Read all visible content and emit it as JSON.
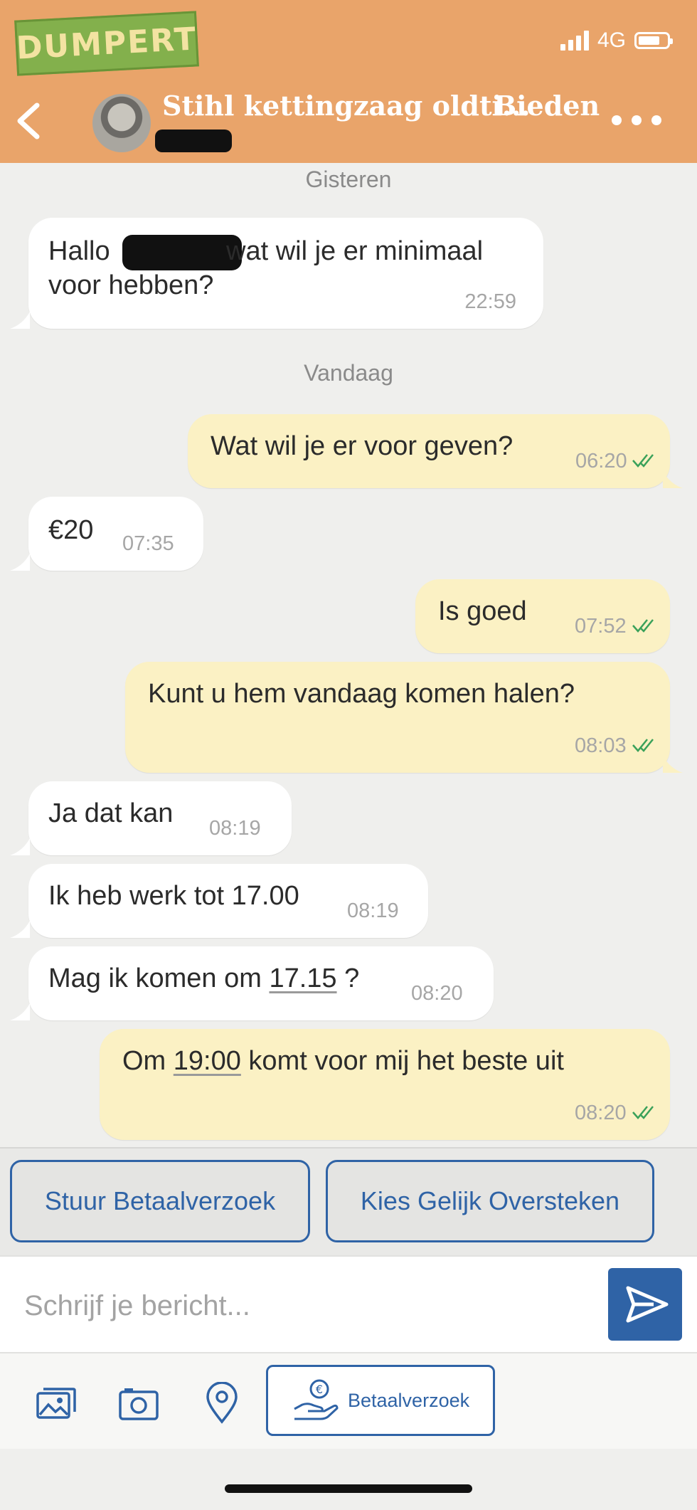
{
  "status_bar": {
    "network": "4G",
    "battery_level": 0.75,
    "watermark": "DUMPERT"
  },
  "header": {
    "title": "Stihl kettingzaag oldti...",
    "bid_label": "Bieden"
  },
  "chat": {
    "day_labels": [
      "Gisteren",
      "Vandaag"
    ],
    "messages": [
      {
        "dir": "in",
        "line1_before": "Hallo",
        "line1_after": "wat wil je er minimaal",
        "line2": "voor hebben?",
        "time": "22:59"
      },
      {
        "dir": "out",
        "text": "Wat wil je er voor geven?",
        "time": "06:20"
      },
      {
        "dir": "in",
        "text": "€20",
        "time": "07:35"
      },
      {
        "dir": "out",
        "text": "Is goed",
        "time": "07:52"
      },
      {
        "dir": "out",
        "text": "Kunt u hem vandaag komen halen?",
        "time": "08:03"
      },
      {
        "dir": "in",
        "text": "Ja dat kan",
        "time": "08:19"
      },
      {
        "dir": "in",
        "text": "Ik heb werk tot 17.00",
        "time": "08:19"
      },
      {
        "dir": "in",
        "before": "Mag ik komen om ",
        "link": "17.15",
        "after": " ?",
        "time": "08:20"
      },
      {
        "dir": "out",
        "before": "Om ",
        "link": "19:00",
        "after": " komt voor mij het beste uit",
        "time": "08:20"
      }
    ]
  },
  "quick_actions": [
    "Stuur Betaalverzoek",
    "Kies Gelijk Oversteken"
  ],
  "composer": {
    "placeholder": "Schrijf je bericht..."
  },
  "toolbar": {
    "pay_request_label": "Betaalverzoek"
  },
  "icons": [
    "back-icon",
    "more-icon",
    "gallery-icon",
    "camera-icon",
    "location-icon",
    "pay-hand-icon",
    "send-icon",
    "double-check-icon"
  ],
  "colors": {
    "header": "#e9a46a",
    "outgoing": "#fbf1c4",
    "incoming": "#ffffff",
    "accent": "#2f63a6",
    "check": "#3aa15a"
  }
}
